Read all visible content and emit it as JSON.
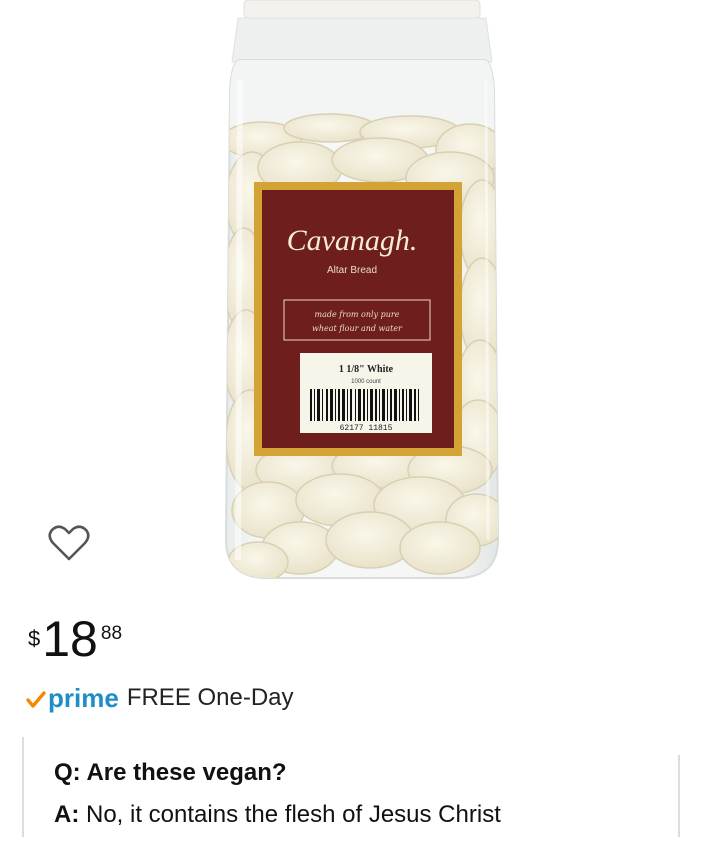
{
  "product": {
    "brand": "Cavanagh.",
    "label_subtitle": "Altar Bread",
    "label_tagline_1": "made from only pure",
    "label_tagline_2": "wheat flour and water",
    "size_label": "1 1/8\" White",
    "count_label": "1000 count",
    "barcode_number": "62177 11815",
    "colors": {
      "label_frame": "#d4a336",
      "label_bg": "#6e1e1c",
      "wafer": "#f1ecd9",
      "jar_lid": "#f4f2ee"
    }
  },
  "wishlist": {
    "icon": "heart-outline-icon"
  },
  "price": {
    "symbol": "$",
    "whole": "18",
    "fraction": "88"
  },
  "prime": {
    "logo": "prime",
    "shipping": "FREE One-Day",
    "check_color": "#f08a00",
    "logo_color": "#1f8dc8"
  },
  "qa": {
    "question_prefix": "Q:",
    "question": "Are these vegan?",
    "answer_prefix": "A:",
    "answer": "No, it contains the flesh of Jesus Christ"
  }
}
